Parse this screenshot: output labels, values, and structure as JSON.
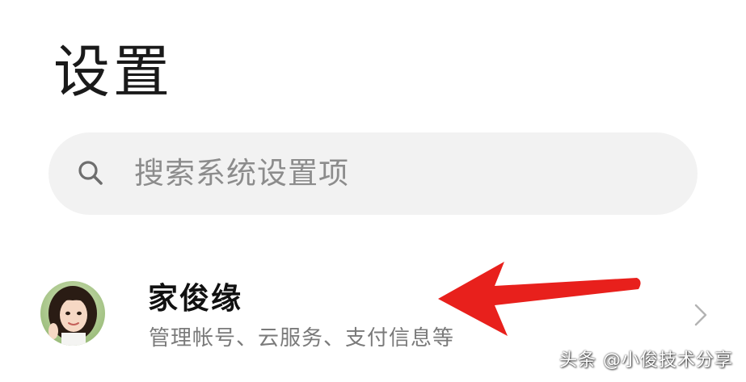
{
  "header": {
    "title": "设置"
  },
  "search": {
    "placeholder": "搜索系统设置项",
    "icon": "search-icon"
  },
  "account": {
    "name": "家俊缘",
    "subtitle": "管理帐号、云服务、支付信息等",
    "avatar_icon": "avatar",
    "chevron_icon": "chevron-right-icon"
  },
  "annotation": {
    "arrow_color": "#e8201c"
  },
  "watermark": {
    "text": "头条 @小俊技术分享"
  },
  "colors": {
    "background": "#ffffff",
    "search_bg": "#f2f2f2",
    "title": "#1a1a1a",
    "placeholder": "#8c8c8c",
    "subtitle": "#7a7a7a"
  }
}
